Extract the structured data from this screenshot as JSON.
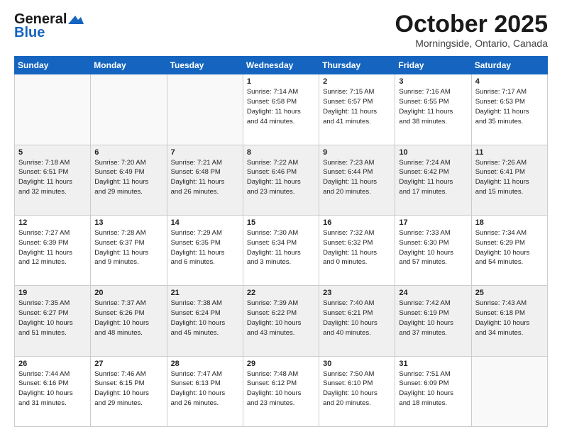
{
  "header": {
    "logo_general": "General",
    "logo_blue": "Blue",
    "title": "October 2025",
    "location": "Morningside, Ontario, Canada"
  },
  "days_of_week": [
    "Sunday",
    "Monday",
    "Tuesday",
    "Wednesday",
    "Thursday",
    "Friday",
    "Saturday"
  ],
  "weeks": [
    [
      {
        "day": "",
        "info": ""
      },
      {
        "day": "",
        "info": ""
      },
      {
        "day": "",
        "info": ""
      },
      {
        "day": "1",
        "info": "Sunrise: 7:14 AM\nSunset: 6:58 PM\nDaylight: 11 hours\nand 44 minutes."
      },
      {
        "day": "2",
        "info": "Sunrise: 7:15 AM\nSunset: 6:57 PM\nDaylight: 11 hours\nand 41 minutes."
      },
      {
        "day": "3",
        "info": "Sunrise: 7:16 AM\nSunset: 6:55 PM\nDaylight: 11 hours\nand 38 minutes."
      },
      {
        "day": "4",
        "info": "Sunrise: 7:17 AM\nSunset: 6:53 PM\nDaylight: 11 hours\nand 35 minutes."
      }
    ],
    [
      {
        "day": "5",
        "info": "Sunrise: 7:18 AM\nSunset: 6:51 PM\nDaylight: 11 hours\nand 32 minutes."
      },
      {
        "day": "6",
        "info": "Sunrise: 7:20 AM\nSunset: 6:49 PM\nDaylight: 11 hours\nand 29 minutes."
      },
      {
        "day": "7",
        "info": "Sunrise: 7:21 AM\nSunset: 6:48 PM\nDaylight: 11 hours\nand 26 minutes."
      },
      {
        "day": "8",
        "info": "Sunrise: 7:22 AM\nSunset: 6:46 PM\nDaylight: 11 hours\nand 23 minutes."
      },
      {
        "day": "9",
        "info": "Sunrise: 7:23 AM\nSunset: 6:44 PM\nDaylight: 11 hours\nand 20 minutes."
      },
      {
        "day": "10",
        "info": "Sunrise: 7:24 AM\nSunset: 6:42 PM\nDaylight: 11 hours\nand 17 minutes."
      },
      {
        "day": "11",
        "info": "Sunrise: 7:26 AM\nSunset: 6:41 PM\nDaylight: 11 hours\nand 15 minutes."
      }
    ],
    [
      {
        "day": "12",
        "info": "Sunrise: 7:27 AM\nSunset: 6:39 PM\nDaylight: 11 hours\nand 12 minutes."
      },
      {
        "day": "13",
        "info": "Sunrise: 7:28 AM\nSunset: 6:37 PM\nDaylight: 11 hours\nand 9 minutes."
      },
      {
        "day": "14",
        "info": "Sunrise: 7:29 AM\nSunset: 6:35 PM\nDaylight: 11 hours\nand 6 minutes."
      },
      {
        "day": "15",
        "info": "Sunrise: 7:30 AM\nSunset: 6:34 PM\nDaylight: 11 hours\nand 3 minutes."
      },
      {
        "day": "16",
        "info": "Sunrise: 7:32 AM\nSunset: 6:32 PM\nDaylight: 11 hours\nand 0 minutes."
      },
      {
        "day": "17",
        "info": "Sunrise: 7:33 AM\nSunset: 6:30 PM\nDaylight: 10 hours\nand 57 minutes."
      },
      {
        "day": "18",
        "info": "Sunrise: 7:34 AM\nSunset: 6:29 PM\nDaylight: 10 hours\nand 54 minutes."
      }
    ],
    [
      {
        "day": "19",
        "info": "Sunrise: 7:35 AM\nSunset: 6:27 PM\nDaylight: 10 hours\nand 51 minutes."
      },
      {
        "day": "20",
        "info": "Sunrise: 7:37 AM\nSunset: 6:26 PM\nDaylight: 10 hours\nand 48 minutes."
      },
      {
        "day": "21",
        "info": "Sunrise: 7:38 AM\nSunset: 6:24 PM\nDaylight: 10 hours\nand 45 minutes."
      },
      {
        "day": "22",
        "info": "Sunrise: 7:39 AM\nSunset: 6:22 PM\nDaylight: 10 hours\nand 43 minutes."
      },
      {
        "day": "23",
        "info": "Sunrise: 7:40 AM\nSunset: 6:21 PM\nDaylight: 10 hours\nand 40 minutes."
      },
      {
        "day": "24",
        "info": "Sunrise: 7:42 AM\nSunset: 6:19 PM\nDaylight: 10 hours\nand 37 minutes."
      },
      {
        "day": "25",
        "info": "Sunrise: 7:43 AM\nSunset: 6:18 PM\nDaylight: 10 hours\nand 34 minutes."
      }
    ],
    [
      {
        "day": "26",
        "info": "Sunrise: 7:44 AM\nSunset: 6:16 PM\nDaylight: 10 hours\nand 31 minutes."
      },
      {
        "day": "27",
        "info": "Sunrise: 7:46 AM\nSunset: 6:15 PM\nDaylight: 10 hours\nand 29 minutes."
      },
      {
        "day": "28",
        "info": "Sunrise: 7:47 AM\nSunset: 6:13 PM\nDaylight: 10 hours\nand 26 minutes."
      },
      {
        "day": "29",
        "info": "Sunrise: 7:48 AM\nSunset: 6:12 PM\nDaylight: 10 hours\nand 23 minutes."
      },
      {
        "day": "30",
        "info": "Sunrise: 7:50 AM\nSunset: 6:10 PM\nDaylight: 10 hours\nand 20 minutes."
      },
      {
        "day": "31",
        "info": "Sunrise: 7:51 AM\nSunset: 6:09 PM\nDaylight: 10 hours\nand 18 minutes."
      },
      {
        "day": "",
        "info": ""
      }
    ]
  ]
}
